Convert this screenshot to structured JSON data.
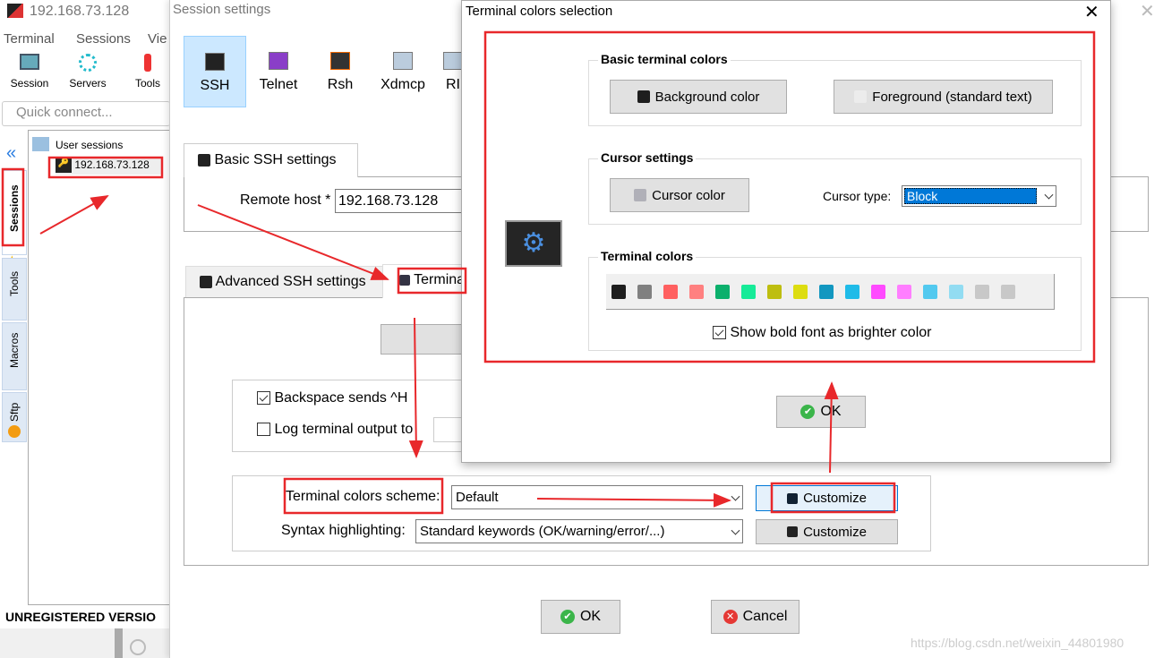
{
  "main_window": {
    "title": "192.168.73.128",
    "menu": [
      "Terminal",
      "Sessions",
      "Vie"
    ],
    "toolbar": [
      {
        "label": "Session",
        "icon": "session-icon"
      },
      {
        "label": "Servers",
        "icon": "servers-icon"
      },
      {
        "label": "Tools",
        "icon": "tools-icon"
      }
    ],
    "quick_connect_placeholder": "Quick connect...",
    "side_tabs": [
      "Sessions",
      "Tools",
      "Macros",
      "Sftp"
    ],
    "tree": {
      "root": "User sessions",
      "items": [
        "192.168.73.128"
      ]
    },
    "status": "UNREGISTERED VERSIO"
  },
  "session_settings": {
    "title": "Session settings",
    "protocols": [
      "SSH",
      "Telnet",
      "Rsh",
      "Xdmcp",
      "RI"
    ],
    "selected_protocol": "SSH",
    "basic_tab": "Basic SSH settings",
    "remote_host_label": "Remote host *",
    "remote_host_value": "192.168.73.128",
    "advanced_tab": "Advanced SSH settings",
    "terminal_tab": "Termina",
    "backspace_label": "Backspace sends ^H",
    "backspace_checked": true,
    "log_label": "Log terminal output to",
    "log_checked": false,
    "colors_scheme_label": "Terminal colors scheme:",
    "colors_scheme_value": "Default",
    "syntax_label": "Syntax highlighting:",
    "syntax_value": "Standard keywords (OK/warning/error/...)",
    "customize_label": "Customize",
    "ok_label": "OK",
    "cancel_label": "Cancel"
  },
  "colors_dialog": {
    "title": "Terminal colors selection",
    "basic_group": "Basic terminal colors",
    "background_btn": "Background color",
    "foreground_btn": "Foreground (standard text)",
    "cursor_group": "Cursor settings",
    "cursor_color_btn": "Cursor color",
    "cursor_type_label": "Cursor type:",
    "cursor_type_value": "Block",
    "terminal_group": "Terminal colors",
    "swatches": [
      "#1e1e1e",
      "#808080",
      "#ff6060",
      "#ff8080",
      "#0cb06c",
      "#16eb98",
      "#bebe10",
      "#dddd10",
      "#1297c0",
      "#1fbbe8",
      "#ff4aff",
      "#ff7eff",
      "#52c9ef",
      "#92dcf2",
      "#c8c8c8",
      "#c8c8c8"
    ],
    "bold_label": "Show bold font as brighter color",
    "bold_checked": true,
    "ok_label": "OK"
  },
  "watermark": "https://blog.csdn.net/weixin_44801980",
  "colors": {
    "annotation": "#e8282b",
    "selection": "#0078d7"
  }
}
